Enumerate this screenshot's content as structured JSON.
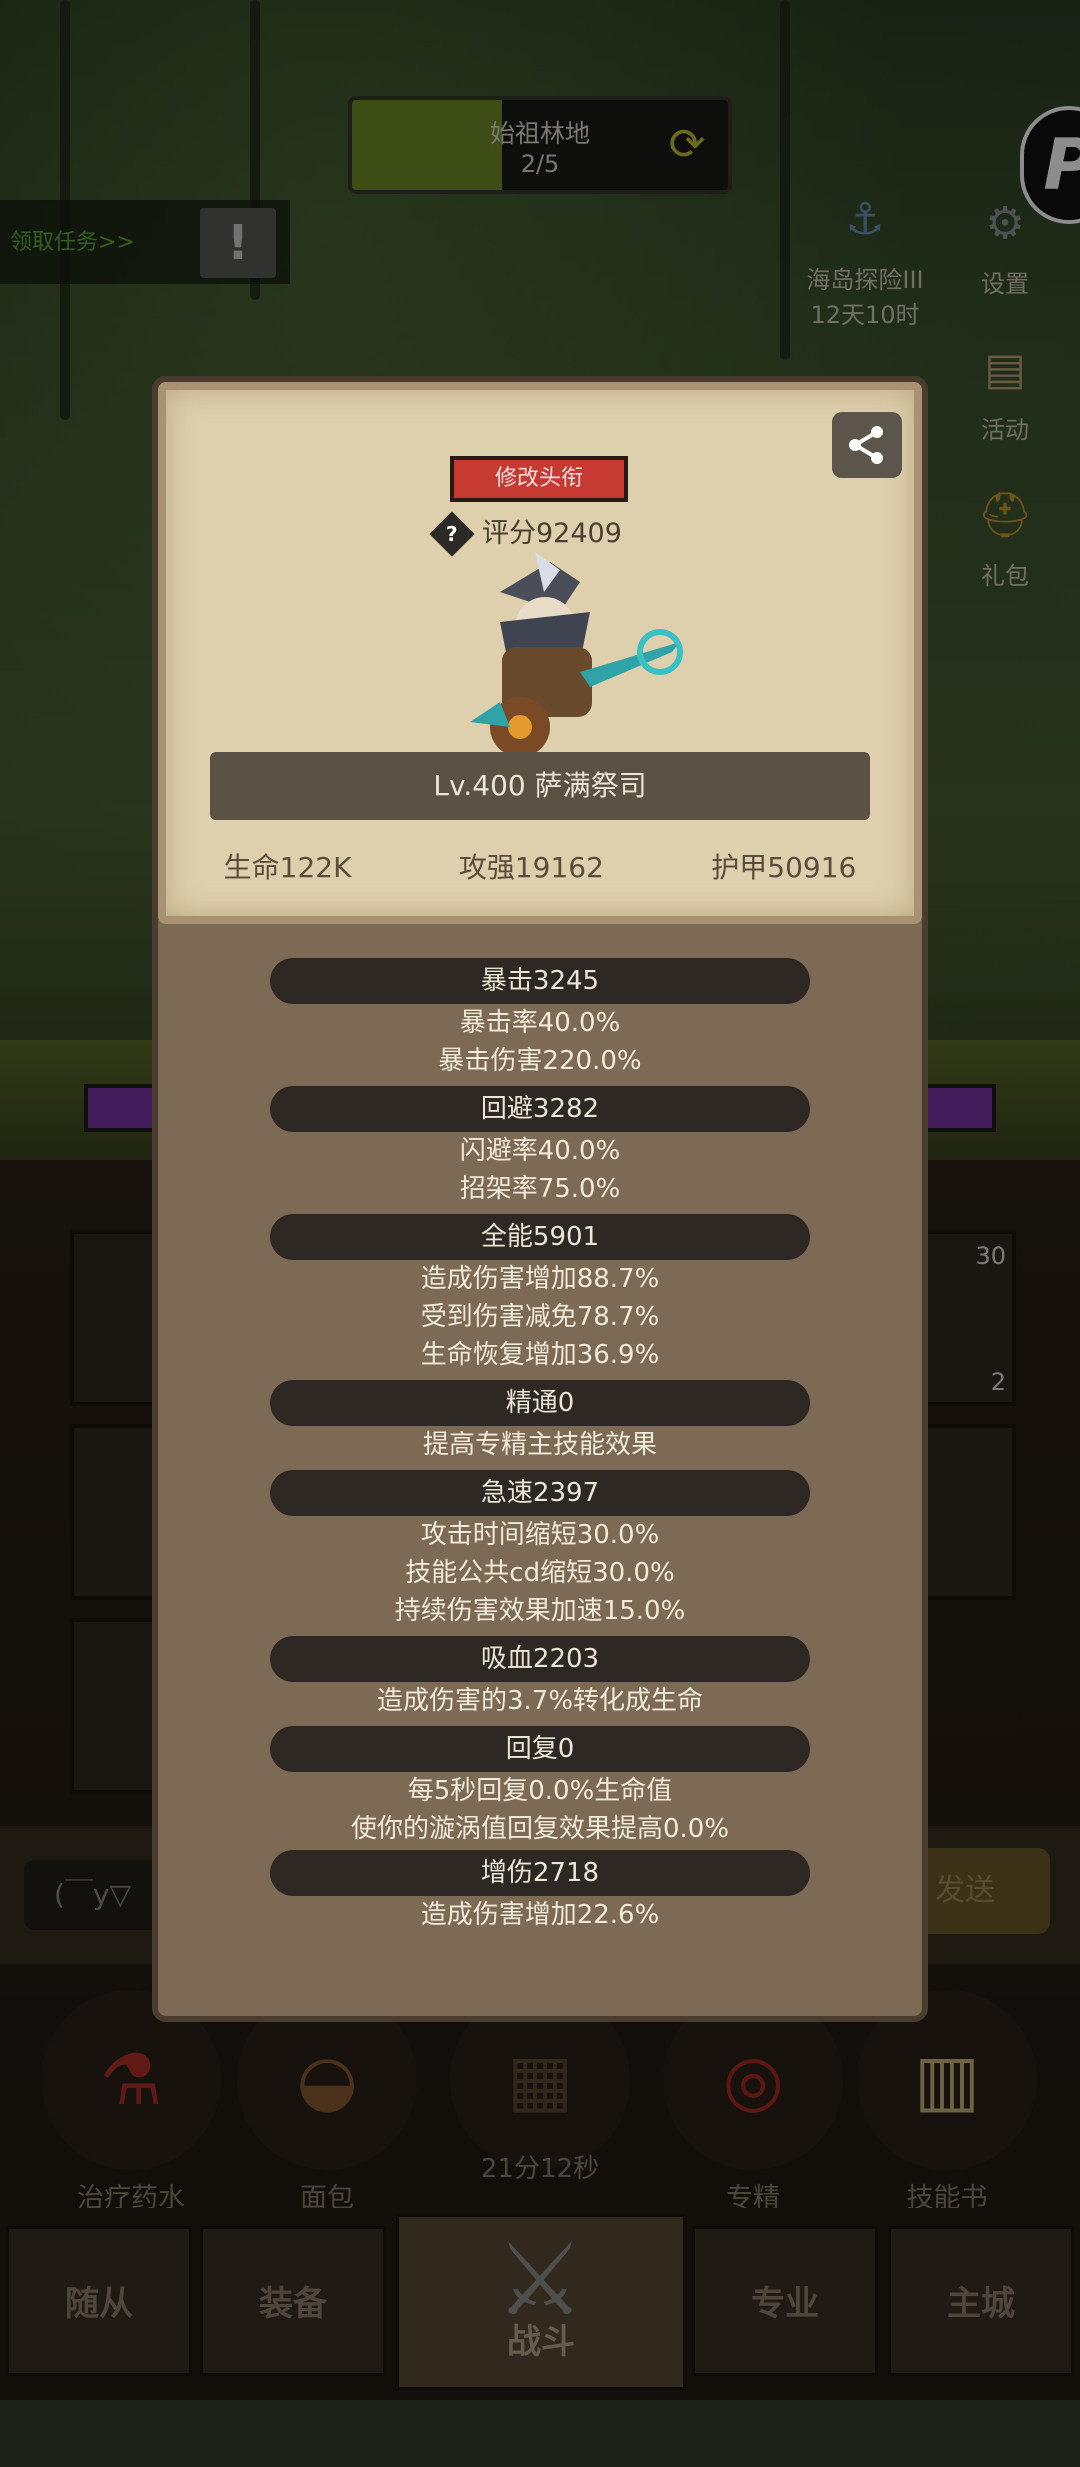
{
  "background": {
    "area": {
      "title": "始祖林地",
      "progress": "2/5",
      "fill_fraction": 0.4
    },
    "quest_label": "领取任务>>",
    "quest_icon": "exclamation-icon",
    "side_buttons": [
      {
        "name": "island-explore",
        "label": "海岛探险III",
        "sub": "12天10时",
        "icon": "anchor-icon"
      },
      {
        "name": "settings",
        "label": "设置",
        "icon": "gear-icon"
      },
      {
        "name": "activity",
        "label": "活动",
        "icon": "scroll-icon"
      },
      {
        "name": "gift",
        "label": "礼包",
        "icon": "helmet-icon"
      }
    ],
    "slot_count_a": "30",
    "slot_count_b": "2",
    "chat_placeholder": "(￣y▽",
    "send_label": "发送",
    "items": [
      {
        "label": "治疗药水",
        "icon": "potion-icon"
      },
      {
        "label": "面包",
        "icon": "bread-icon"
      },
      {
        "label": "21分12秒",
        "icon": "chest-icon"
      },
      {
        "label": "专精",
        "icon": "target-icon"
      },
      {
        "label": "技能书",
        "icon": "book-icon"
      }
    ],
    "nav": [
      "随从",
      "装备",
      "战斗",
      "专业",
      "主城"
    ]
  },
  "modal": {
    "title_button": "修改头衔",
    "score": "评分92409",
    "character": "Lv.400 萨满祭司",
    "base_stats": [
      "生命122K",
      "攻强19162",
      "护甲50916"
    ],
    "stats": [
      {
        "head": "暴击3245",
        "lines": [
          "暴击率40.0%",
          "暴击伤害220.0%"
        ]
      },
      {
        "head": "回避3282",
        "lines": [
          "闪避率40.0%",
          "招架率75.0%"
        ]
      },
      {
        "head": "全能5901",
        "lines": [
          "造成伤害增加88.7%",
          "受到伤害减免78.7%",
          "生命恢复增加36.9%"
        ]
      },
      {
        "head": "精通0",
        "lines": [
          "提高专精主技能效果"
        ]
      },
      {
        "head": "急速2397",
        "lines": [
          "攻击时间缩短30.0%",
          "技能公共cd缩短30.0%",
          "持续伤害效果加速15.0%"
        ]
      },
      {
        "head": "吸血2203",
        "lines": [
          "造成伤害的3.7%转化成生命"
        ]
      },
      {
        "head": "回复0",
        "lines": [
          "每5秒回复0.0%生命值",
          "使你的漩涡值回复效果提高0.0%"
        ]
      },
      {
        "head": "增伤2718",
        "lines": [
          "造成伤害增加22.6%"
        ]
      }
    ]
  }
}
